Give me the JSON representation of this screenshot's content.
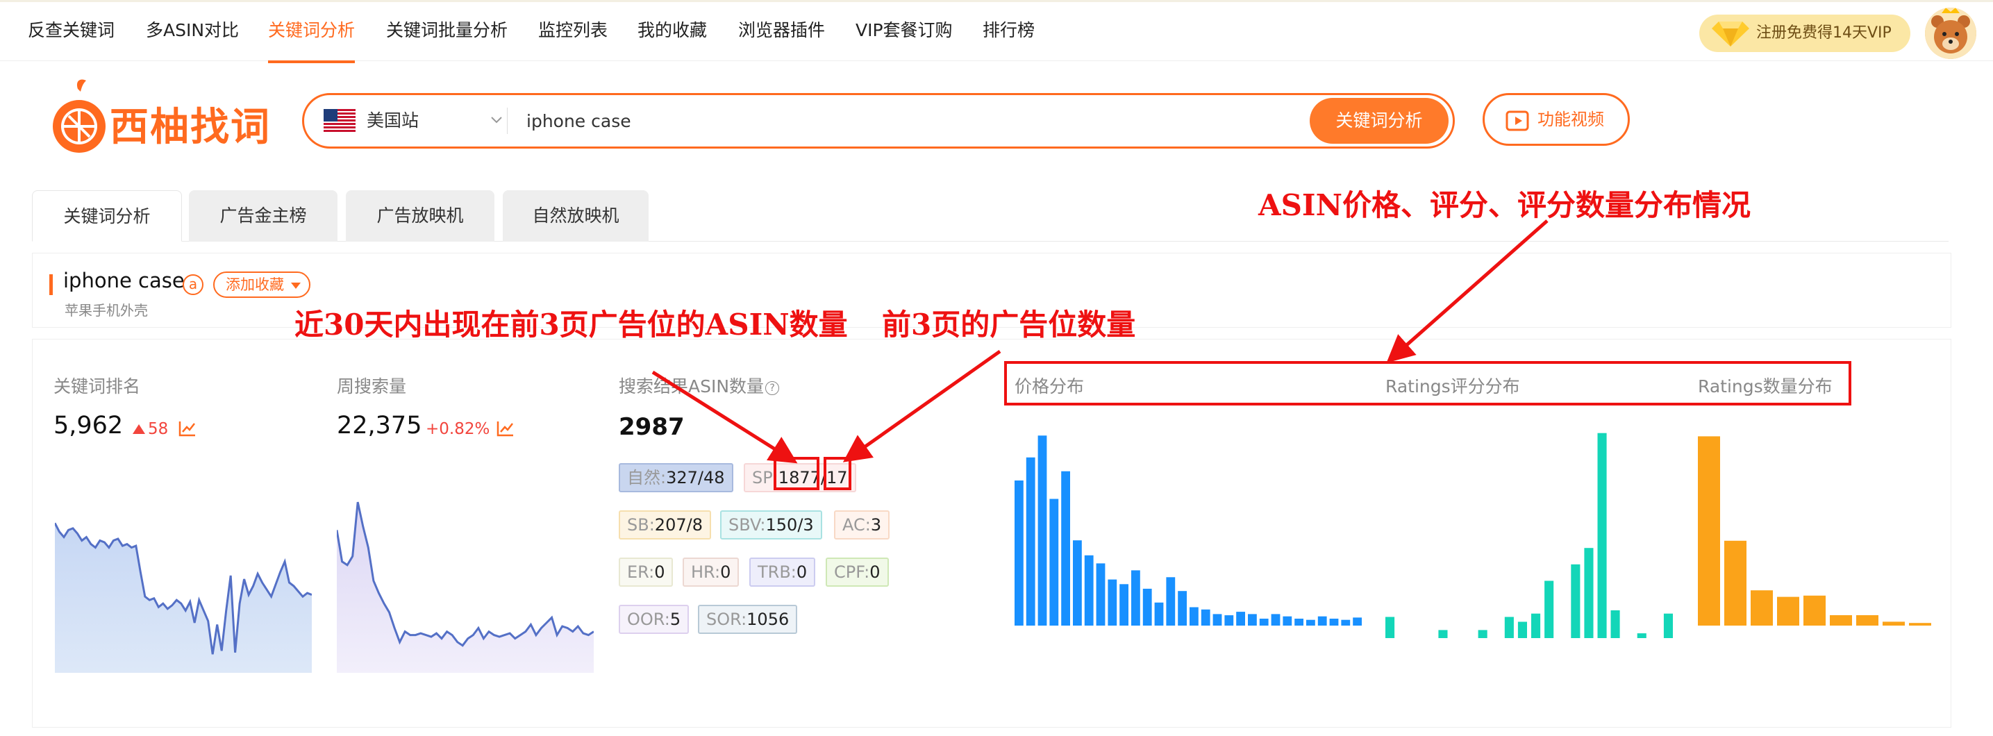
{
  "nav": {
    "items": [
      "反查关键词",
      "多ASIN对比",
      "关键词分析",
      "关键词批量分析",
      "监控列表",
      "我的收藏",
      "浏览器插件",
      "VIP套餐订购",
      "排行榜"
    ],
    "active_index": 2,
    "vip_banner": "注册免费得14天VIP"
  },
  "logo": {
    "name": "西柚找词"
  },
  "search": {
    "site": "美国站",
    "query": "iphone case",
    "button": "关键词分析"
  },
  "video_button": "功能视频",
  "tabs": [
    "关键词分析",
    "广告金主榜",
    "广告放映机",
    "自然放映机"
  ],
  "keyword": {
    "title": "iphone case",
    "amazon_badge": "a",
    "favorite_button": "添加收藏",
    "subtitle": "苹果手机外壳"
  },
  "metrics": {
    "rank": {
      "label": "关键词排名",
      "value": "5,962",
      "change": "58",
      "direction": "up"
    },
    "weekly_search": {
      "label": "周搜索量",
      "value": "22,375",
      "change": "+0.82%"
    },
    "asin_count": {
      "label": "搜索结果ASIN数量",
      "help": "?",
      "value": "2987"
    }
  },
  "ad_chips": [
    {
      "k": "自然",
      "v": "327/48",
      "bg": "#c9d6ef",
      "border": "#a7b9de"
    },
    {
      "k": "SP",
      "v": "1877/17",
      "bg": "#fdf0f0",
      "border": "#f6d7d7"
    },
    {
      "k": "SB",
      "v": "207/8",
      "bg": "#fdf4e3",
      "border": "#f6dfae"
    },
    {
      "k": "SBV",
      "v": "150/3",
      "bg": "#e8f8f8",
      "border": "#a9e2e2"
    },
    {
      "k": "AC",
      "v": "3",
      "bg": "#fff4ee",
      "border": "#f8d9c5"
    },
    {
      "k": "ER",
      "v": "0",
      "bg": "#f9f9f2",
      "border": "#e8e8d2"
    },
    {
      "k": "HR",
      "v": "0",
      "bg": "#fbf4f2",
      "border": "#ecd8d2"
    },
    {
      "k": "TRB",
      "v": "0",
      "bg": "#eeeefb",
      "border": "#ccccf0"
    },
    {
      "k": "CPF",
      "v": "0",
      "bg": "#f1f9e8",
      "border": "#cfe8b6"
    },
    {
      "k": "OOR",
      "v": "5",
      "bg": "#f6f2fb",
      "border": "#ddd0ee"
    },
    {
      "k": "SOR",
      "v": "1056",
      "bg": "#eef3f7",
      "border": "#b8c9d6"
    }
  ],
  "distributions": {
    "price_label": "价格分布",
    "ratings_label": "Ratings评分分布",
    "ratings_count_label": "Ratings数量分布"
  },
  "chart_data": [
    {
      "type": "area",
      "title": "",
      "y": [
        0.84,
        0.79,
        0.76,
        0.8,
        0.81,
        0.78,
        0.74,
        0.76,
        0.72,
        0.7,
        0.74,
        0.73,
        0.7,
        0.74,
        0.75,
        0.71,
        0.72,
        0.7,
        0.71,
        0.56,
        0.42,
        0.4,
        0.41,
        0.36,
        0.38,
        0.35,
        0.37,
        0.4,
        0.38,
        0.34,
        0.39,
        0.27,
        0.4,
        0.34,
        0.28,
        0.09,
        0.26,
        0.11,
        0.34,
        0.54,
        0.1,
        0.38,
        0.52,
        0.43,
        0.48,
        0.55,
        0.5,
        0.46,
        0.42,
        0.49,
        0.56,
        0.62,
        0.5,
        0.48,
        0.45,
        0.42,
        0.44,
        0.43
      ]
    },
    {
      "type": "area",
      "title": "",
      "y": [
        0.8,
        0.62,
        0.6,
        0.65,
        0.96,
        0.82,
        0.7,
        0.51,
        0.44,
        0.38,
        0.33,
        0.24,
        0.16,
        0.22,
        0.2,
        0.2,
        0.21,
        0.2,
        0.19,
        0.21,
        0.18,
        0.22,
        0.2,
        0.16,
        0.14,
        0.18,
        0.2,
        0.24,
        0.18,
        0.22,
        0.2,
        0.19,
        0.2,
        0.21,
        0.18,
        0.2,
        0.22,
        0.26,
        0.2,
        0.24,
        0.27,
        0.3,
        0.2,
        0.25,
        0.24,
        0.22,
        0.25,
        0.21,
        0.2,
        0.22
      ]
    },
    {
      "type": "bar",
      "title": "价格分布",
      "color": "#1890ff",
      "values": [
        126,
        146,
        165,
        110,
        134,
        74,
        61,
        54,
        40,
        36,
        48,
        32,
        20,
        42,
        30,
        16,
        14,
        10,
        9,
        12,
        10,
        6,
        10,
        8,
        6,
        5,
        8,
        6,
        5,
        7
      ]
    },
    {
      "type": "bar",
      "title": "Ratings评分分布",
      "color": "#13d6b8",
      "values": [
        18,
        2,
        3,
        1,
        10,
        5,
        1,
        10,
        1,
        18,
        15,
        20,
        40,
        0,
        50,
        60,
        130,
        22,
        0,
        8,
        2,
        20
      ]
    },
    {
      "type": "bar",
      "title": "Ratings数量分布",
      "color": "#fba319",
      "values": [
        145,
        65,
        27,
        22,
        23,
        8,
        8,
        3,
        2
      ]
    }
  ],
  "annotations": {
    "asin_ads": "近30天内出现在前3页广告位的ASIN数量",
    "ad_slots": "前3页的广告位数量",
    "dist": "ASIN价格、评分、评分数量分布情况"
  }
}
